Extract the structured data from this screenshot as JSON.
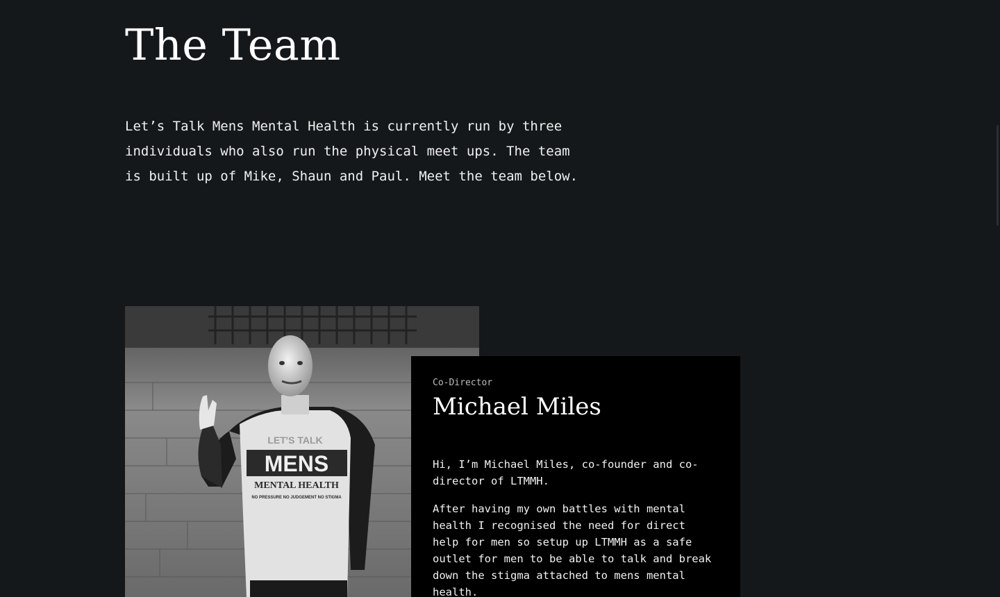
{
  "section": {
    "title": "The Team",
    "intro": "Let’s Talk Mens Mental Health is currently run by three individuals who also run the physical meet ups. The team is built up of Mike, Shaun and Paul. Meet the team below."
  },
  "member": {
    "role": "Co-Director",
    "name": "Michael Miles",
    "bio": [
      "Hi, I’m Michael Miles, co-founder and co-director of LTMMH.",
      "After having my own battles with mental health I recognised the need for direct help for men so setup up LTMMH as a safe outlet for men to be able to talk and break down the stigma attached to mens mental health."
    ],
    "photo": {
      "description_icon": "portrait-photo",
      "shirt_text": {
        "top": "LET'S TALK",
        "middle": "MENS",
        "bottom": "MENTAL HEALTH",
        "small": "NO PRESSURE NO JUDGEMENT NO STIGMA"
      }
    }
  },
  "colors": {
    "background": "#15181b",
    "card": "#000000",
    "text": "#ffffff"
  }
}
